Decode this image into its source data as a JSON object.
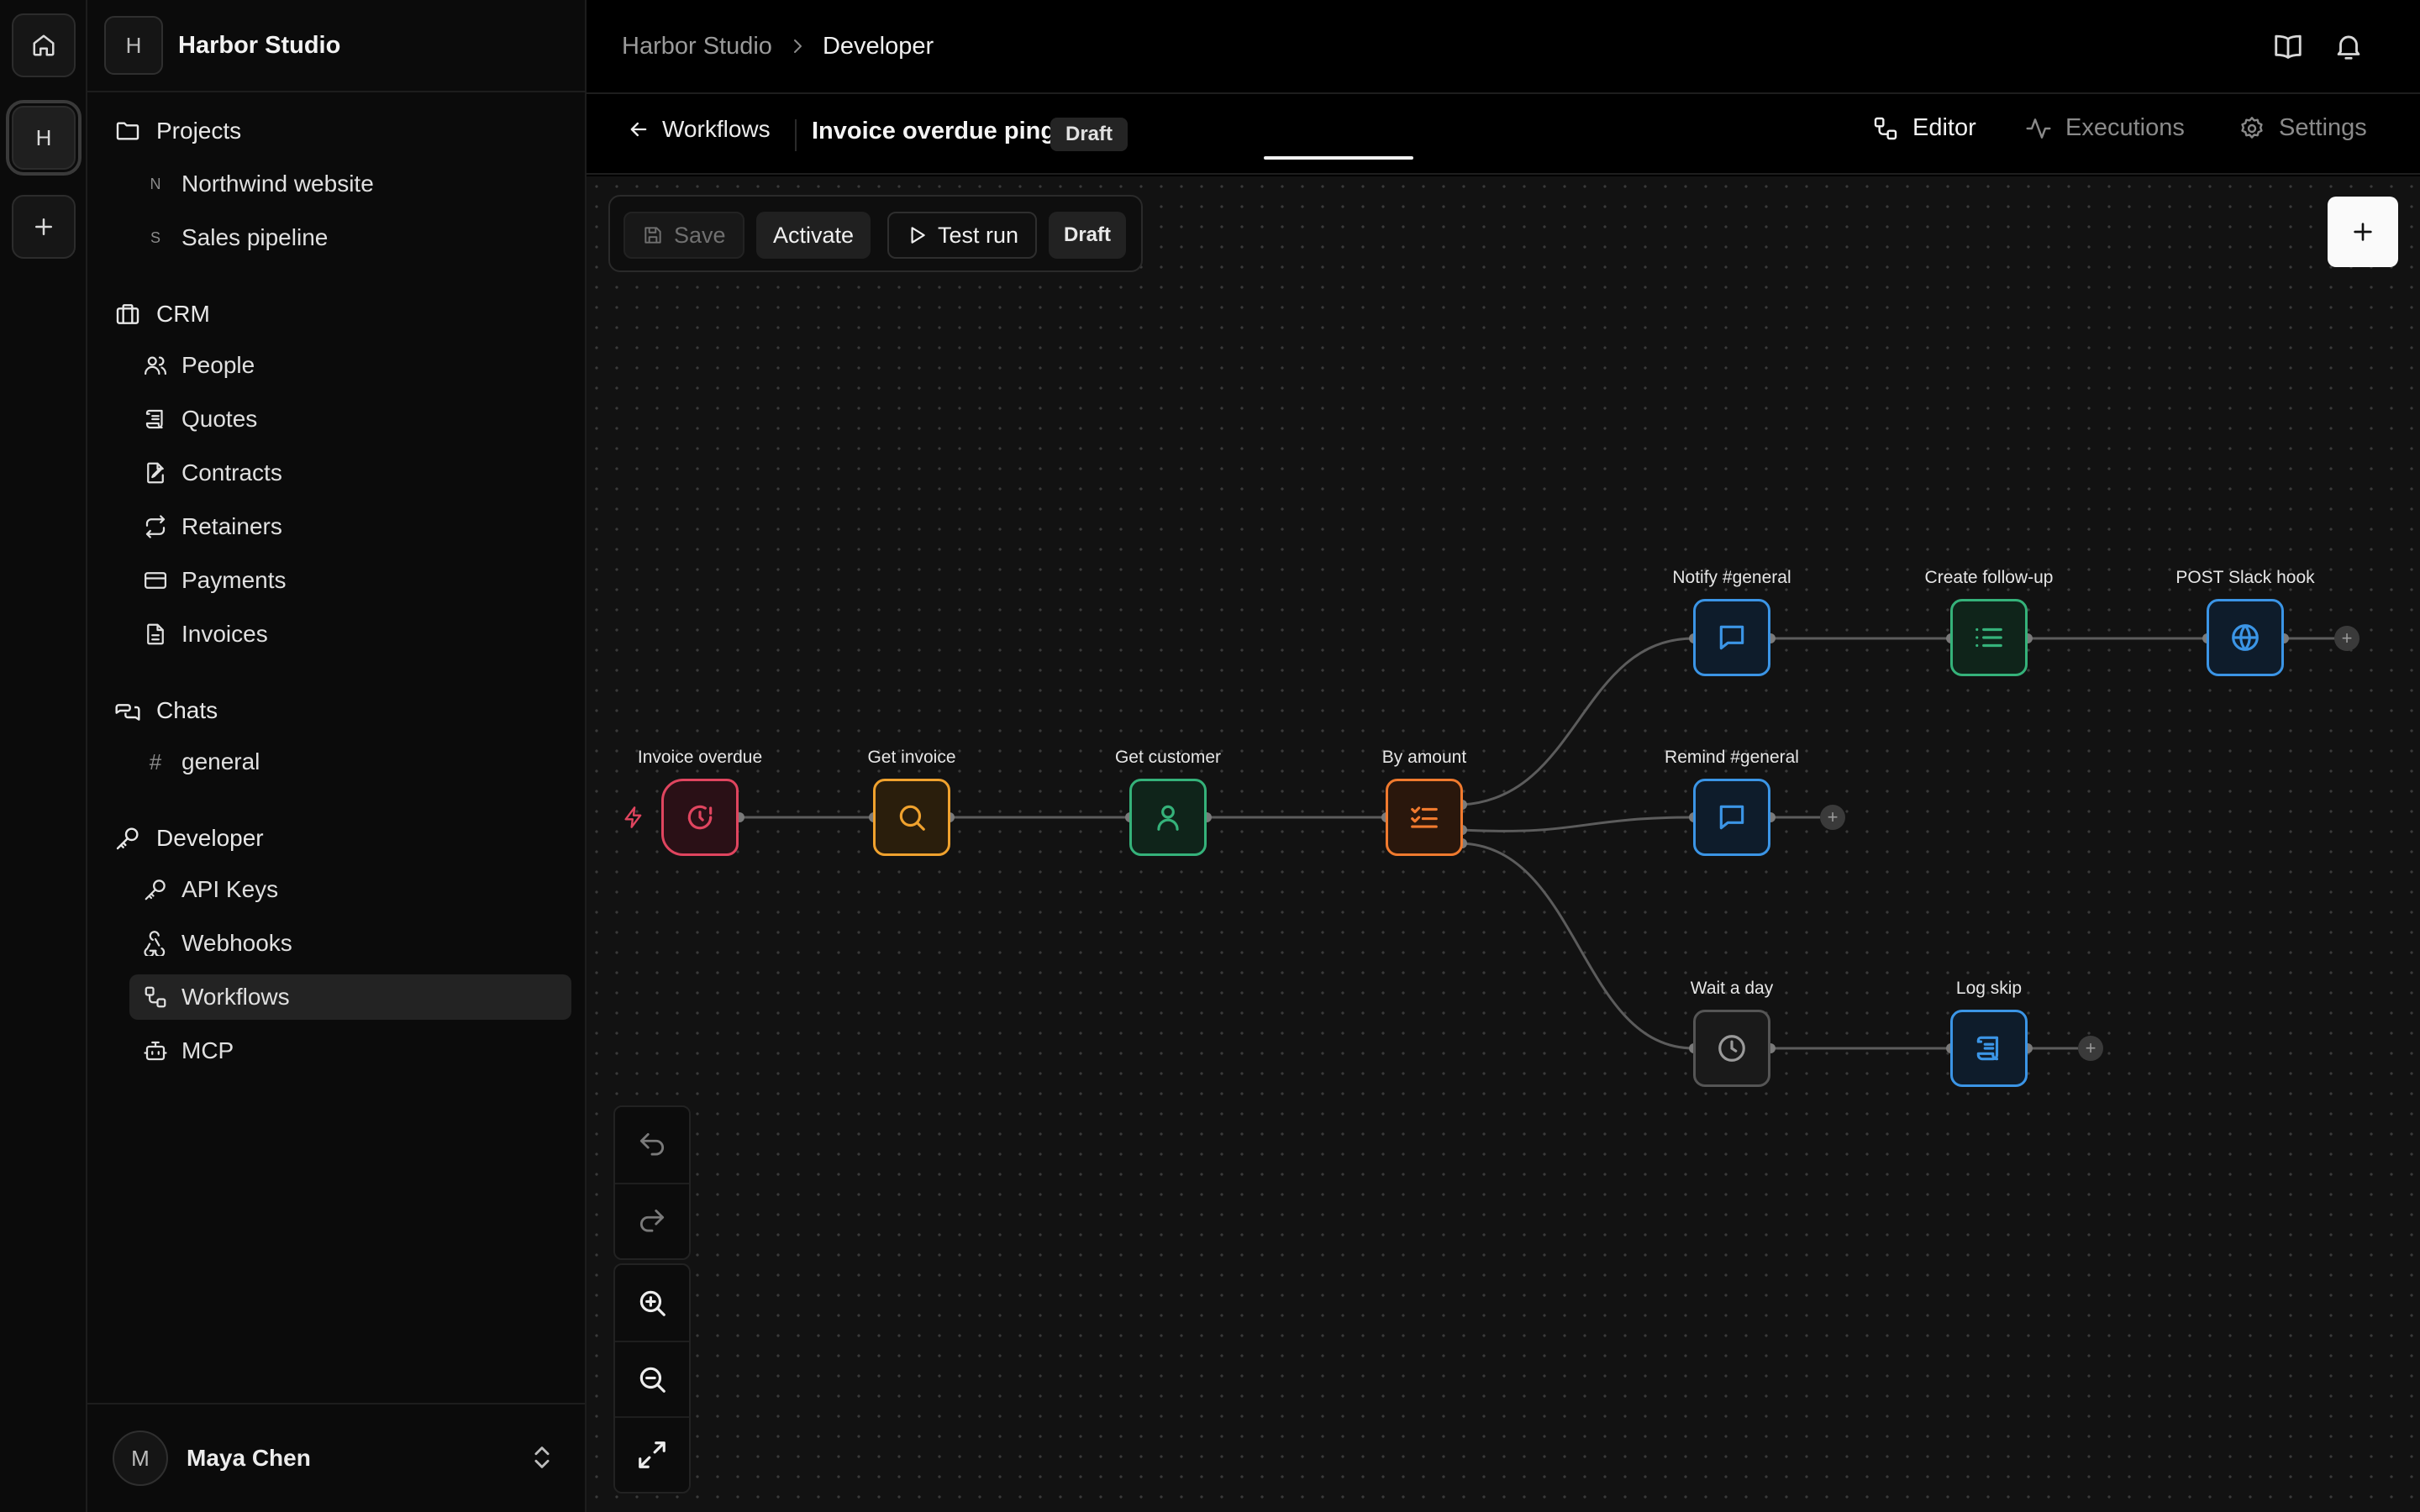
{
  "rail": {
    "home_icon": "home-icon",
    "workspace_letter": "H",
    "add_icon": "plus-icon"
  },
  "sidebar": {
    "workspace": {
      "letter": "H",
      "name": "Harbor Studio"
    },
    "projects": {
      "label": "Projects",
      "items": [
        {
          "letter": "N",
          "label": "Northwind website"
        },
        {
          "letter": "S",
          "label": "Sales pipeline"
        }
      ]
    },
    "crm": {
      "label": "CRM",
      "items": [
        {
          "label": "People",
          "icon": "people-icon"
        },
        {
          "label": "Quotes",
          "icon": "scroll-icon"
        },
        {
          "label": "Contracts",
          "icon": "file-signature-icon"
        },
        {
          "label": "Retainers",
          "icon": "repeat-icon"
        },
        {
          "label": "Payments",
          "icon": "credit-card-icon"
        },
        {
          "label": "Invoices",
          "icon": "file-text-icon"
        }
      ]
    },
    "chats": {
      "label": "Chats",
      "items": [
        {
          "label": "general"
        }
      ]
    },
    "developer": {
      "label": "Developer",
      "items": [
        {
          "label": "API Keys",
          "icon": "key-icon"
        },
        {
          "label": "Webhooks",
          "icon": "webhook-icon"
        },
        {
          "label": "Workflows",
          "icon": "workflow-icon",
          "active": true
        },
        {
          "label": "MCP",
          "icon": "bot-icon"
        }
      ]
    },
    "user": {
      "initial": "M",
      "name": "Maya Chen"
    }
  },
  "topbar": {
    "crumbs": [
      "Harbor Studio",
      "Developer"
    ]
  },
  "workflow": {
    "back_label": "Workflows",
    "title": "Invoice overdue ping",
    "status": "Draft",
    "tabs": [
      {
        "label": "Editor",
        "active": true
      },
      {
        "label": "Executions"
      },
      {
        "label": "Settings"
      }
    ]
  },
  "toolbar": {
    "save": "Save",
    "activate": "Activate",
    "test_run": "Test run",
    "status": "Draft"
  },
  "nodes": [
    {
      "label": "Invoice overdue",
      "color": "#e0455f",
      "icon": "clock-alert-icon"
    },
    {
      "label": "Get invoice",
      "color": "#f0a22e",
      "icon": "search-icon"
    },
    {
      "label": "Get customer",
      "color": "#35b27a",
      "icon": "user-icon"
    },
    {
      "label": "By amount",
      "color": "#f07a2e",
      "icon": "list-checks-icon"
    },
    {
      "label": "Notify #general",
      "color": "#3b95e6",
      "icon": "message-icon"
    },
    {
      "label": "Create follow-up",
      "color": "#35b27a",
      "icon": "list-icon"
    },
    {
      "label": "POST Slack hook",
      "color": "#3b95e6",
      "icon": "globe-icon"
    },
    {
      "label": "Remind #general",
      "color": "#3b95e6",
      "icon": "message-icon"
    },
    {
      "label": "Wait a day",
      "color": "#8a8a8a",
      "icon": "clock-icon"
    },
    {
      "label": "Log skip",
      "color": "#3b95e6",
      "icon": "scroll-icon"
    }
  ],
  "colors": {
    "canvas_bg": "#121212",
    "accent_red": "#e0455f",
    "accent_blue": "#3b95e6"
  }
}
